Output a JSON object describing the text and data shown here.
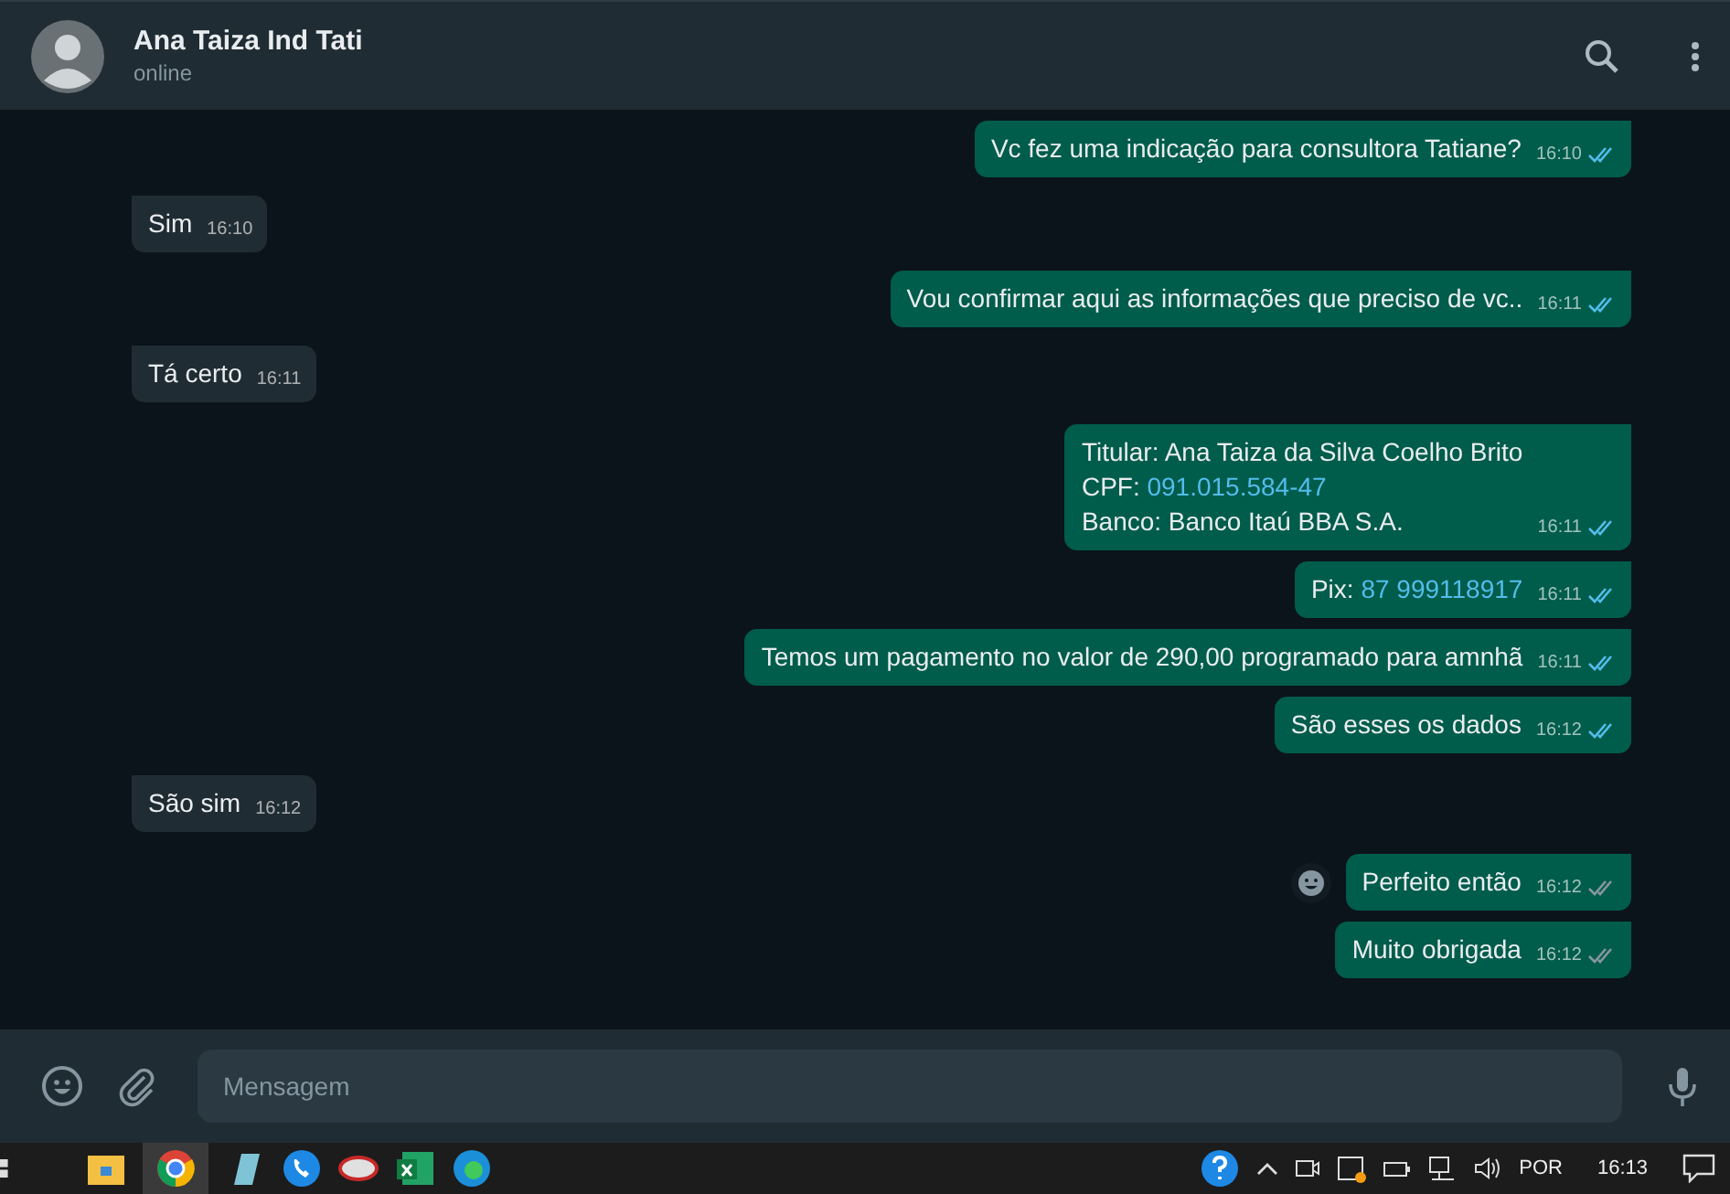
{
  "header": {
    "name": "Ana Taiza Ind Tati",
    "status": "online"
  },
  "messages": [
    {
      "kind": "out",
      "lines": [
        [
          {
            "text": "Vc fez uma indicação para consultora Tatiane?"
          }
        ]
      ],
      "time": "16:10",
      "read": true
    },
    {
      "kind": "in",
      "lines": [
        [
          {
            "text": "Sim"
          }
        ]
      ],
      "time": "16:10"
    },
    {
      "kind": "out",
      "lines": [
        [
          {
            "text": "Vou confirmar aqui as informações que preciso de vc.."
          }
        ]
      ],
      "time": "16:11",
      "read": true
    },
    {
      "kind": "in",
      "lines": [
        [
          {
            "text": "Tá certo"
          }
        ]
      ],
      "time": "16:11"
    },
    {
      "kind": "out",
      "lines": [
        [
          {
            "text": "Titular: Ana Taiza da Silva Coelho Brito"
          }
        ],
        [
          {
            "text": "CPF: "
          },
          {
            "text": "091.015.584-47",
            "link": true
          }
        ],
        [
          {
            "text": "Banco: Banco Itaú BBA S.A."
          }
        ]
      ],
      "time": "16:11",
      "read": true
    },
    {
      "kind": "out",
      "lines": [
        [
          {
            "text": "Pix: "
          },
          {
            "text": "87 999118917",
            "link": true
          }
        ]
      ],
      "time": "16:11",
      "read": true
    },
    {
      "kind": "out",
      "lines": [
        [
          {
            "text": "Temos um pagamento no valor de 290,00 programado para amnhã"
          }
        ]
      ],
      "time": "16:11",
      "read": true
    },
    {
      "kind": "out",
      "lines": [
        [
          {
            "text": "São esses os dados"
          }
        ]
      ],
      "time": "16:12",
      "read": true
    },
    {
      "kind": "in",
      "lines": [
        [
          {
            "text": "São sim"
          }
        ]
      ],
      "time": "16:12"
    },
    {
      "kind": "out",
      "lines": [
        [
          {
            "text": "Perfeito então"
          }
        ]
      ],
      "time": "16:12",
      "read": false,
      "emoji_button": true
    },
    {
      "kind": "out",
      "lines": [
        [
          {
            "text": "Muito obrigada"
          }
        ]
      ],
      "time": "16:12",
      "read": false
    }
  ],
  "composer": {
    "placeholder": "Mensagem"
  },
  "taskbar": {
    "language": "POR",
    "clock": "16:13"
  }
}
